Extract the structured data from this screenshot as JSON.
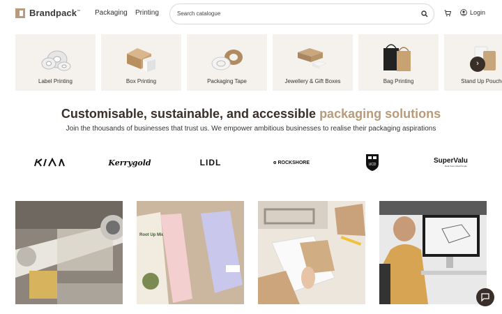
{
  "header": {
    "logo_text": "Brandpack",
    "logo_tm": "™",
    "nav": [
      "Packaging",
      "Printing"
    ],
    "search_placeholder": "Search catalogue",
    "login_label": "Login"
  },
  "categories": [
    {
      "label": "Label Printing"
    },
    {
      "label": "Box Printing"
    },
    {
      "label": "Packaging Tape"
    },
    {
      "label": "Jewellery & Gift Boxes"
    },
    {
      "label": "Bag Printing"
    },
    {
      "label": "Stand Up Pouches"
    }
  ],
  "carousel_next_icon": "chevron-right-icon",
  "hero": {
    "headline_main": "Customisable, sustainable, and accessible ",
    "headline_accent": "packaging solutions",
    "subline": "Join the thousands of businesses that trust us. We empower ambitious businesses to realise their packaging aspirations"
  },
  "brands": [
    "KIA",
    "Kerrygold",
    "LIDL",
    "ROCKSHORE",
    "UCD",
    "SuperValu"
  ],
  "brand_supervalu_tagline": "Real Food, Real People",
  "photo_box_text": "Root Up Microgreens",
  "colors": {
    "accent": "#b89b7b",
    "dark": "#3a2e28",
    "card_bg": "#f5f2ed"
  }
}
